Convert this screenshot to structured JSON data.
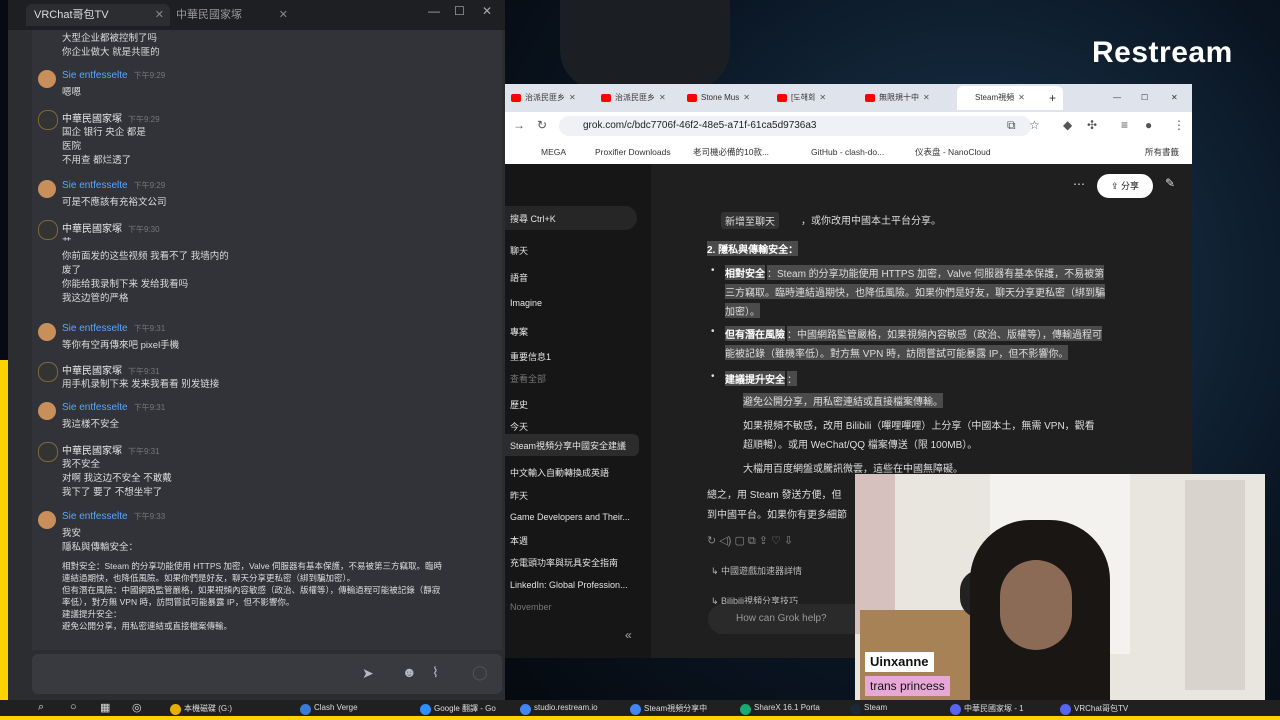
{
  "stream": {
    "logo": "Restream"
  },
  "chat": {
    "tabs": [
      {
        "label": "VRChat哥包TV"
      },
      {
        "label": "中華民國家塚"
      }
    ],
    "top_lines": [
      "大型企业都被控制了吗",
      "你企业做大 就是共匪的"
    ],
    "messages": [
      {
        "author": "Sie entfesselte",
        "time": "下午9:29",
        "type": "sie",
        "lines": [
          "嗯嗯"
        ]
      },
      {
        "author": "中華民國家塚",
        "time": "下午9:29",
        "type": "china",
        "lines": [
          "国企 银行 央企 都是",
          "医院",
          "不用查 都烂透了"
        ]
      },
      {
        "author": "Sie entfesselte",
        "time": "下午9:29",
        "type": "sie",
        "lines": [
          "可是不應該有充裕文公司"
        ]
      },
      {
        "author": "中華民國家塚",
        "time": "下午9:30",
        "type": "china",
        "lines": [
          "艹",
          "你前面发的这些视频 我看不了 我墙内的",
          "废了",
          "你能给我录制下来 发给我看吗",
          "我这边管的严格"
        ]
      },
      {
        "author": "Sie entfesselte",
        "time": "下午9:31",
        "type": "sie",
        "lines": [
          "等你有空再傳來吧 pixel手機"
        ]
      },
      {
        "author": "中華民國家塚",
        "time": "下午9:31",
        "type": "china",
        "lines": [
          "用手机录制下来 发来我看看 别发链接"
        ]
      },
      {
        "author": "Sie entfesselte",
        "time": "下午9:31",
        "type": "sie",
        "lines": [
          "我這樣不安全"
        ]
      },
      {
        "author": "中華民國家塚",
        "time": "下午9:31",
        "type": "china",
        "lines": [
          "我不安全",
          "对啊 我这边不安全 不敢戴",
          "我下了 要了 不想坐牢了"
        ]
      },
      {
        "author": "Sie entfesselte",
        "time": "下午9:33",
        "type": "sie",
        "lines": [
          "我安",
          "隱私與傳輸安全："
        ]
      }
    ],
    "bottom_lines": [
      "相對安全：Steam 的分享功能使用 HTTPS 加密，Valve 伺服器有基本保護，不易被第三方竊取。臨時",
      "連結過期快，也降低風險。如果你們是好友，聊天分享更私密（綁到騙加密）。",
      "但有潛在風險：中國網路監管嚴格，如果視頻內容敏感（政治、版權等），傳輸過程可能被記錄（靜寂",
      "率低），對方無 VPN 時，訪問嘗試可能暴露 IP，但不影響你。",
      "建議提升安全：",
      "避免公開分享，用私密連結或直接檔案傳輸。"
    ]
  },
  "browser": {
    "tabs": [
      {
        "label": "治派民匪乡"
      },
      {
        "label": "治派民匪乡"
      },
      {
        "label": "Stone Mus"
      },
      {
        "label": "[도해회"
      },
      {
        "label": "無限規十中"
      },
      {
        "label": "Steam視頻"
      }
    ],
    "url": "grok.com/c/bdc7706f-46f2-48e5-a71f-61ca5d9736a3",
    "bookmarks": [
      "MEGA",
      "Proxifier Downloads",
      "老司機必備的10款...",
      "GitHub - clash-do...",
      "仪表盘 - NanoCloud",
      "所有書籤"
    ]
  },
  "grok": {
    "sidebar": {
      "search": "搜尋 Ctrl+K",
      "items": [
        "聊天",
        "語音",
        "Imagine",
        "專案",
        "重要信息1",
        "查看全部",
        "歷史",
        "今天",
        "Steam視頻分享中國安全建議",
        "中文輸入自動轉換成英語",
        "昨天",
        "Game Developers and Their...",
        "本週",
        "充電頭功率與玩具安全指南",
        "LinkedIn: Global Profession...",
        "November"
      ]
    },
    "share_label": "分享",
    "top_line": "新增至聊天",
    "top_line_tail": "，或你改用中國本土平台分享。",
    "section_title": "2. 隱私與傳輸安全：",
    "bullets": [
      [
        "相對安全",
        "：Steam 的分享功能使用 HTTPS 加密，Valve 伺服器有基本保護，不易被第",
        "三方竊取。臨時連結過期快，也降低風險。如果你們是好友，聊天分享更私密（綁到騙",
        "加密）。"
      ],
      [
        "但有潛在風險",
        "：中國網路監管嚴格，如果視頻內容敏感（政治、版權等），傳輸過程可",
        "能被記錄（雖機率低）。對方無 VPN 時，訪問嘗試可能暴露 IP，但不影響你。"
      ],
      [
        "建議提升安全",
        "："
      ]
    ],
    "sub_bullets": [
      "避免公開分享，用私密連結或直接檔案傳輸。",
      "如果視頻不敏感，改用 Bilibili（嗶哩嗶哩）上分享（中國本土，無需 VPN，觀看",
      "超順暢）。或用 WeChat/QQ 檔案傳送（限 100MB）。",
      "大檔用百度網盤或騰訊微雲，這些在中國無障礙。"
    ],
    "summary": [
      "總之，用 Steam 發送方便，但",
      "到中國平台。如果你有更多細節"
    ],
    "related": [
      "中國遊戲加速器詳情",
      "Bilibili視頻分享技巧"
    ],
    "ask_placeholder": "How can Grok help?"
  },
  "webcam": {
    "name": "Uinxanne",
    "tagline": "trans princess"
  },
  "taskbar": {
    "items": [
      "本機磁碟 (G:)",
      "Clash Verge",
      "Google 翻譯 - Go",
      "studio.restream.io",
      "Steam視頻分享中",
      "ShareX 16.1 Porta",
      "Steam",
      "中華民國家塚 - 1",
      "VRChat哥包TV"
    ]
  }
}
